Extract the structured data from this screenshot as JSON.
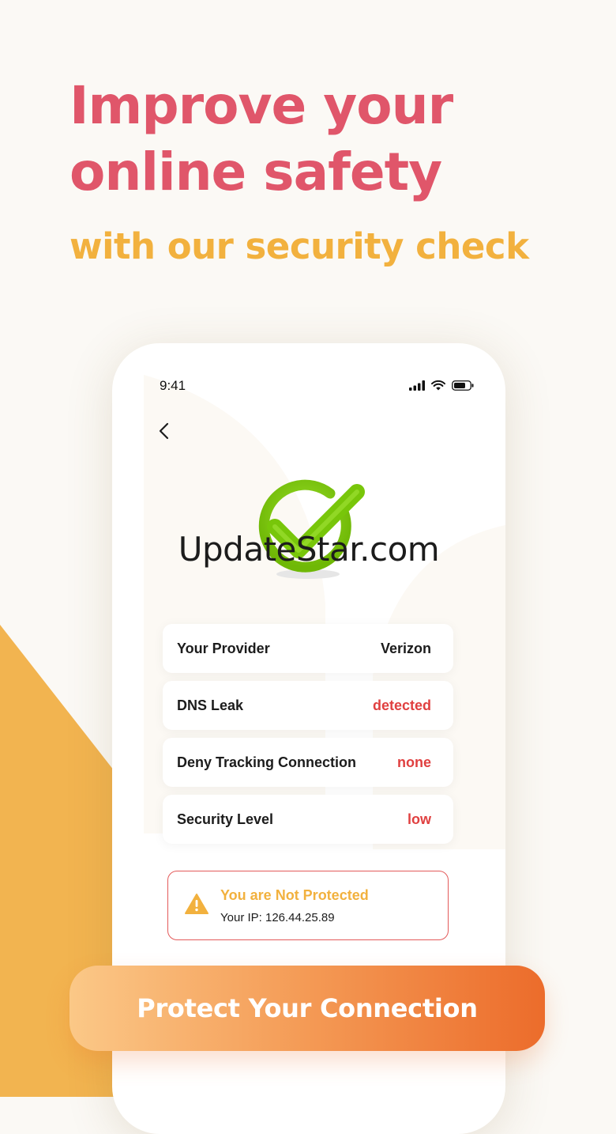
{
  "header": {
    "headline_line1": "Improve your",
    "headline_line2": "online safety",
    "subheadline": "with our security check"
  },
  "status_bar": {
    "time": "9:41"
  },
  "watermark": "UpdateStar.com",
  "info_rows": [
    {
      "label": "Your Provider",
      "value": "Verizon"
    },
    {
      "label": "DNS Leak",
      "value": "detected"
    },
    {
      "label": "Deny Tracking Connection",
      "value": "none"
    },
    {
      "label": "Security Level",
      "value": "low"
    }
  ],
  "alert": {
    "title": "You are Not Protected",
    "ip_text": "Your IP: 126.44.25.89"
  },
  "cta": {
    "label": "Protect Your Connection"
  },
  "colors": {
    "headline": "#e0566a",
    "subheadline": "#f2b13e",
    "check_green": "#7cc90b",
    "danger": "#e04040",
    "cta_start": "#fbc887",
    "cta_end": "#ec6c2b"
  }
}
